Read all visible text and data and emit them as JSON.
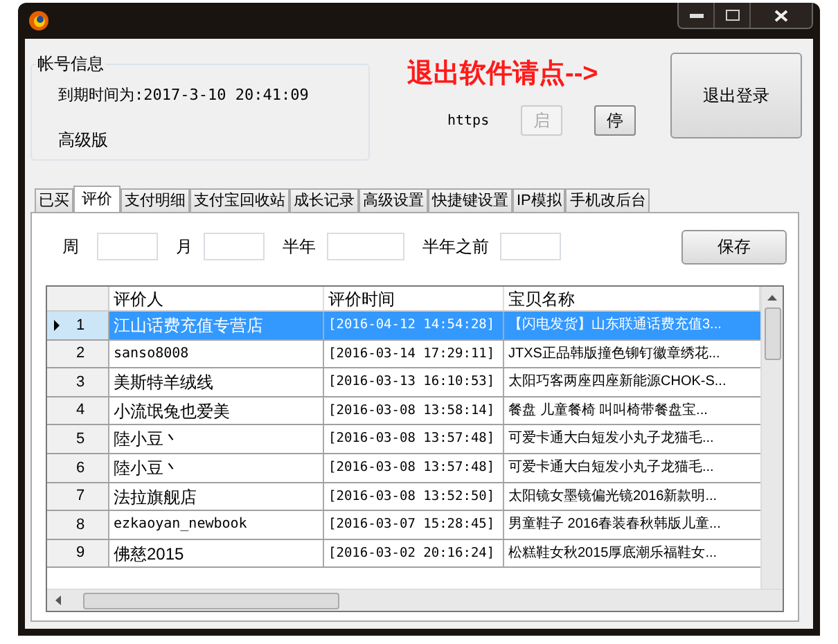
{
  "account": {
    "title": "帐号信息",
    "expiry": "到期时间为:2017-3-10 20:41:09",
    "edition": "高级版"
  },
  "exit_hint": "退出软件请点-->",
  "proxy": {
    "label": "https",
    "buttons": [
      {
        "label": "启",
        "disabled": true
      },
      {
        "label": "停",
        "disabled": false
      }
    ]
  },
  "logout_button": "退出登录",
  "tabs": [
    {
      "label": "已买",
      "selected": false
    },
    {
      "label": "评价",
      "selected": true
    },
    {
      "label": "支付明细",
      "selected": false
    },
    {
      "label": "支付宝回收站",
      "selected": false
    },
    {
      "label": "成长记录",
      "selected": false
    },
    {
      "label": "高级设置",
      "selected": false
    },
    {
      "label": "快捷键设置",
      "selected": false
    },
    {
      "label": "IP模拟",
      "selected": false
    },
    {
      "label": "手机改后台",
      "selected": false
    }
  ],
  "filters": [
    {
      "label": "周"
    },
    {
      "label": "月"
    },
    {
      "label": "半年"
    },
    {
      "label": "半年之前"
    }
  ],
  "save_button": "保存",
  "table": {
    "columns": [
      "评价人",
      "评价时间",
      "宝贝名称"
    ],
    "rows": [
      {
        "index": "1",
        "reviewer": "江山话费充值专营店",
        "time": "[2016-04-12 14:54:28]",
        "item": "【闪电发货】山东联通话费充值3...",
        "selected": true
      },
      {
        "index": "2",
        "reviewer": "sanso8008",
        "time": "[2016-03-14 17:29:11]",
        "item": "JTXS正品韩版撞色铆钉徽章绣花...",
        "selected": false
      },
      {
        "index": "3",
        "reviewer": "美斯特羊绒线",
        "time": "[2016-03-13 16:10:53]",
        "item": "太阳巧客两座四座新能源CHOK-S...",
        "selected": false
      },
      {
        "index": "4",
        "reviewer": "小流氓兔也爱美",
        "time": "[2016-03-08 13:58:14]",
        "item": "餐盘 儿童餐椅 叫叫椅带餐盘宝...",
        "selected": false
      },
      {
        "index": "5",
        "reviewer": "陸小豆丶",
        "time": "[2016-03-08 13:57:48]",
        "item": "可爱卡通大白短发小丸子龙猫毛...",
        "selected": false
      },
      {
        "index": "6",
        "reviewer": "陸小豆丶",
        "time": "[2016-03-08 13:57:48]",
        "item": "可爱卡通大白短发小丸子龙猫毛...",
        "selected": false
      },
      {
        "index": "7",
        "reviewer": "法拉旗舰店",
        "time": "[2016-03-08 13:52:50]",
        "item": "太阳镜女墨镜偏光镜2016新款明...",
        "selected": false
      },
      {
        "index": "8",
        "reviewer": "ezkaoyan_newbook",
        "time": "[2016-03-07 15:28:45]",
        "item": "男童鞋子 2016春装春秋韩版儿童...",
        "selected": false
      },
      {
        "index": "9",
        "reviewer": "佛慈2015",
        "time": "[2016-03-02 20:16:24]",
        "item": "松糕鞋女秋2015厚底潮乐福鞋女...",
        "selected": false
      }
    ]
  }
}
